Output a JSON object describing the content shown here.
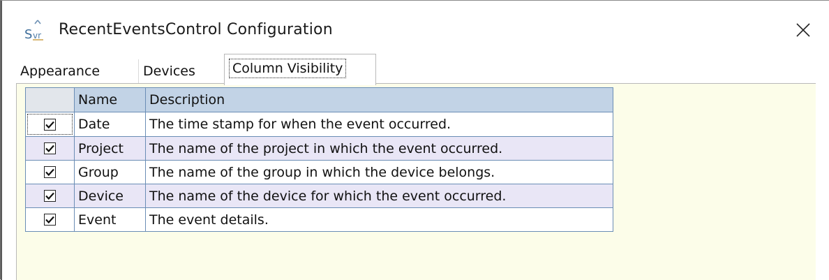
{
  "window": {
    "title": "RecentEventsControl Configuration",
    "icon": "svr-config-icon",
    "close_icon": "close-icon"
  },
  "tabs": [
    {
      "label": "Appearance",
      "active": false
    },
    {
      "label": "Devices",
      "active": false
    },
    {
      "label": "Column Visibility",
      "active": true
    }
  ],
  "grid": {
    "columns": [
      "",
      "Name",
      "Description"
    ],
    "rows": [
      {
        "checked": true,
        "name": "Date",
        "description": "The time stamp for when the event occurred."
      },
      {
        "checked": true,
        "name": "Project",
        "description": "The name of the project in which the event occurred."
      },
      {
        "checked": true,
        "name": "Group",
        "description": "The name of the group in which the device belongs."
      },
      {
        "checked": true,
        "name": "Device",
        "description": "The name of the device for which the event occurred."
      },
      {
        "checked": true,
        "name": "Event",
        "description": "The event details."
      }
    ]
  },
  "colors": {
    "panel_background": "#fcfde9",
    "header_background": "#c2d3e6",
    "alt_row_background": "#e9e6f6",
    "grid_border": "#6a8db5"
  }
}
